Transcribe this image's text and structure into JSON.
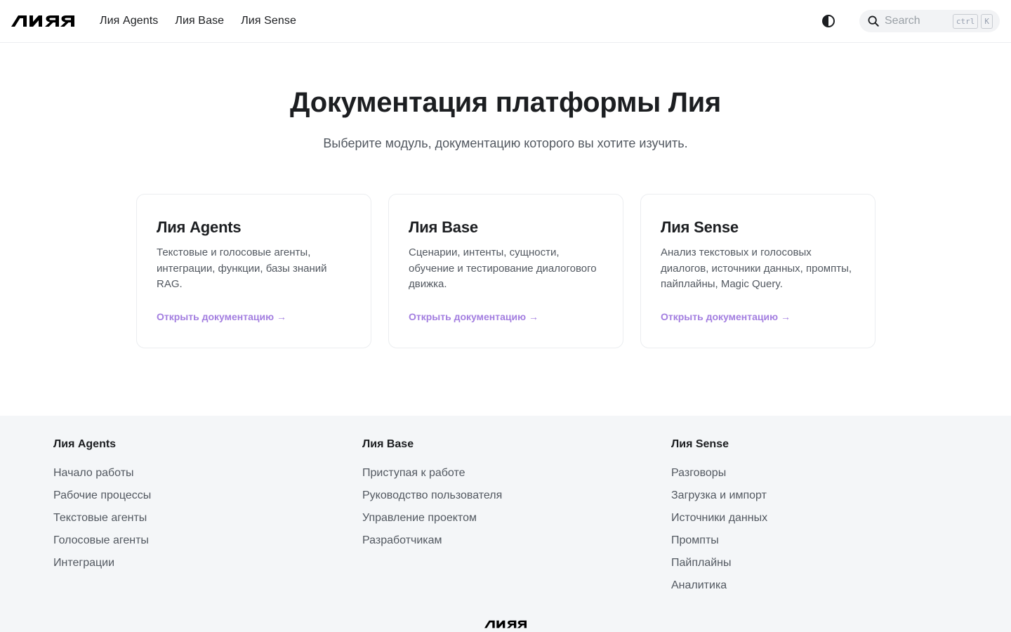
{
  "header": {
    "logo_alt": "Лия",
    "nav": [
      "Лия Agents",
      "Лия Base",
      "Лия Sense"
    ],
    "search": {
      "placeholder": "Search",
      "keys": [
        "ctrl",
        "K"
      ]
    }
  },
  "hero": {
    "title": "Документация платформы Лия",
    "subtitle": "Выберите модуль, документацию которого вы хотите изучить."
  },
  "cards": [
    {
      "title": "Лия Agents",
      "description": "Текстовые и голосовые агенты, интеграции, функции, базы знаний RAG.",
      "link": "Открыть документацию →"
    },
    {
      "title": "Лия Base",
      "description": "Сценарии, интенты, сущности, обучение и тестирование диалогового движка.",
      "link": "Открыть документацию →"
    },
    {
      "title": "Лия Sense",
      "description": "Анализ текстовых и голосовых диалогов, источники данных, промпты, пайплайны, Magic Query.",
      "link": "Открыть документацию →"
    }
  ],
  "footer": {
    "columns": [
      {
        "heading": "Лия Agents",
        "items": [
          "Начало работы",
          "Рабочие процессы",
          "Текстовые агенты",
          "Голосовые агенты",
          "Интеграции"
        ]
      },
      {
        "heading": "Лия Base",
        "items": [
          "Приступая к работе",
          "Руководство пользователя",
          "Управление проектом",
          "Разработчикам"
        ]
      },
      {
        "heading": "Лия Sense",
        "items": [
          "Разговоры",
          "Загрузка и импорт",
          "Источники данных",
          "Промпты",
          "Пайплайны",
          "Аналитика"
        ]
      }
    ]
  },
  "colors": {
    "accent": "#a37ee0",
    "footer_bg": "#f4f6f8",
    "text": "#1c1e21",
    "muted": "#525860"
  },
  "icons": {
    "theme": "contrast-half-circle-icon",
    "search": "magnifier-icon"
  }
}
